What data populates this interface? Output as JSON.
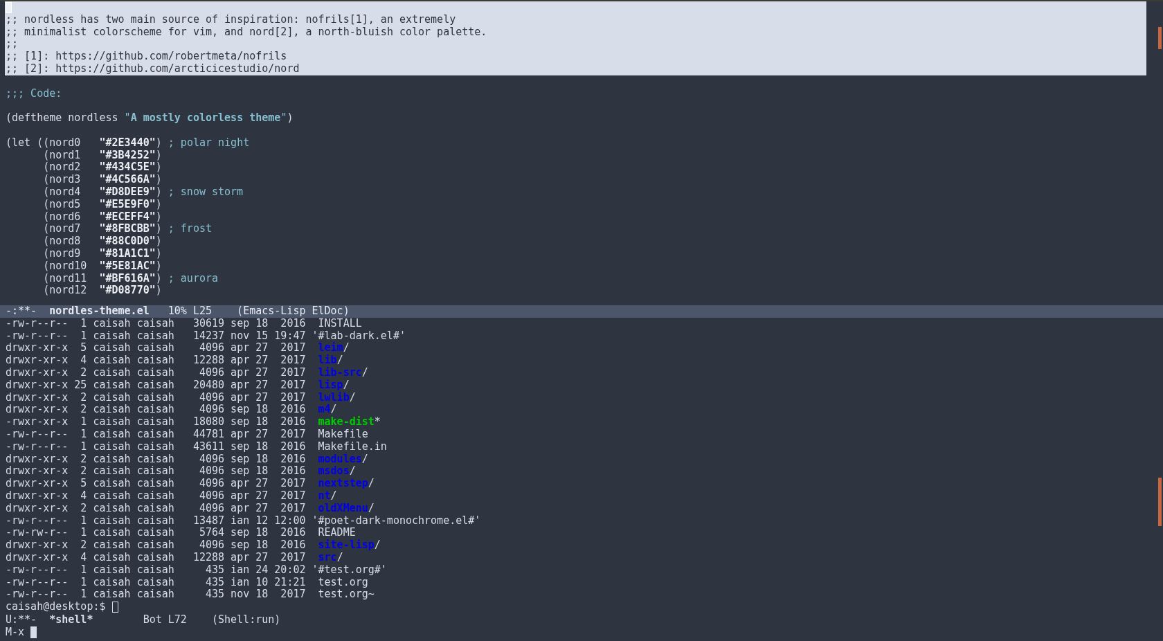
{
  "editor": {
    "lines": [
      {
        "kind": "cursor",
        "highlighted": true
      },
      {
        "kind": "code",
        "highlighted": true,
        "segments": [
          {
            "text": ";; nordless has two main source of inspiration: nofrils[1], an extremely",
            "kind": "comment"
          }
        ]
      },
      {
        "kind": "code",
        "highlighted": true,
        "segments": [
          {
            "text": ";; minimalist colorscheme for vim, and nord[2], a north-bluish color palette.",
            "kind": "comment"
          }
        ]
      },
      {
        "kind": "code",
        "highlighted": true,
        "segments": [
          {
            "text": ";;",
            "kind": "comment"
          }
        ]
      },
      {
        "kind": "code",
        "highlighted": true,
        "segments": [
          {
            "text": ";; [1]: https://github.com/robertmeta/nofrils",
            "kind": "comment"
          }
        ]
      },
      {
        "kind": "code",
        "highlighted": true,
        "segments": [
          {
            "text": ";; [2]: https://github.com/arcticicestudio/nord",
            "kind": "comment"
          }
        ]
      },
      {
        "kind": "blank",
        "highlighted": false
      },
      {
        "kind": "code",
        "highlighted": false,
        "segments": [
          {
            "text": ";;; Code:",
            "kind": "comment"
          }
        ]
      },
      {
        "kind": "blank",
        "highlighted": false
      },
      {
        "kind": "code",
        "highlighted": false,
        "segments": [
          {
            "text": "(deftheme nordless ",
            "kind": "plain"
          },
          {
            "text": "\"",
            "kind": "doc-delim"
          },
          {
            "text": "A mostly colorless theme",
            "kind": "doc"
          },
          {
            "text": "\"",
            "kind": "doc-delim"
          },
          {
            "text": ")",
            "kind": "plain"
          }
        ]
      },
      {
        "kind": "blank",
        "highlighted": false
      },
      {
        "kind": "code",
        "highlighted": false,
        "segments": [
          {
            "text": "(let ((nord0   ",
            "kind": "plain"
          },
          {
            "text": "\"#2E3440\"",
            "kind": "string"
          },
          {
            "text": ")",
            "kind": "plain"
          },
          {
            "text": "; polar night",
            "kind": "comment"
          }
        ],
        "children": [
          {
            "kind": "code",
            "highlighted": false,
            "segments": [
              {
                "text": "(nord1   ",
                "kind": "plain"
              },
              {
                "text": "\"#3B4252\"",
                "kind": "string"
              },
              {
                "text": ")",
                "kind": "plain"
              }
            ]
          },
          {
            "kind": "code",
            "highlighted": false,
            "segments": [
              {
                "text": "(nord2   ",
                "kind": "plain"
              },
              {
                "text": "\"#434C5E\"",
                "kind": "string"
              },
              {
                "text": ")",
                "kind": "plain"
              }
            ]
          },
          {
            "kind": "code",
            "highlighted": false,
            "segments": [
              {
                "text": "(nord3   ",
                "kind": "plain"
              },
              {
                "text": "\"#4C566A\"",
                "kind": "string"
              },
              {
                "text": ")",
                "kind": "plain"
              }
            ]
          },
          {
            "kind": "code",
            "highlighted": false,
            "segments": [
              {
                "text": "(nord4   ",
                "kind": "plain"
              },
              {
                "text": "\"#D8DEE9\"",
                "kind": "string"
              },
              {
                "text": ")",
                "kind": "plain"
              },
              {
                "text": "; snow storm",
                "kind": "comment"
              }
            ]
          },
          {
            "kind": "code",
            "highlighted": false,
            "segments": [
              {
                "text": "(nord5   ",
                "kind": "plain"
              },
              {
                "text": "\"#E5E9F0\"",
                "kind": "string"
              },
              {
                "text": ")",
                "kind": "plain"
              }
            ]
          },
          {
            "kind": "code",
            "highlighted": false,
            "segments": [
              {
                "text": "(nord6   ",
                "kind": "plain"
              },
              {
                "text": "\"#ECEFF4\"",
                "kind": "string"
              },
              {
                "text": ")",
                "kind": "plain"
              }
            ]
          },
          {
            "kind": "code",
            "highlighted": false,
            "segments": [
              {
                "text": "(nord7   ",
                "kind": "plain"
              },
              {
                "text": "\"#8FBCBB\"",
                "kind": "string"
              },
              {
                "text": ")",
                "kind": "plain"
              },
              {
                "text": "; frost",
                "kind": "comment"
              }
            ]
          },
          {
            "kind": "code",
            "highlighted": false,
            "segments": [
              {
                "text": "(nord8   ",
                "kind": "plain"
              },
              {
                "text": "\"#88C0D0\"",
                "kind": "string"
              },
              {
                "text": ")",
                "kind": "plain"
              }
            ]
          },
          {
            "kind": "code",
            "highlighted": false,
            "segments": [
              {
                "text": "(nord9   ",
                "kind": "plain"
              },
              {
                "text": "\"#81A1C1\"",
                "kind": "string"
              },
              {
                "text": ")",
                "kind": "plain"
              }
            ]
          },
          {
            "kind": "code",
            "highlighted": false,
            "segments": [
              {
                "text": "(nord10  ",
                "kind": "plain"
              },
              {
                "text": "\"#5E81AC\"",
                "kind": "string"
              },
              {
                "text": ")",
                "kind": "plain"
              }
            ]
          },
          {
            "kind": "code",
            "highlighted": false,
            "segments": [
              {
                "text": "(nord11  ",
                "kind": "plain"
              },
              {
                "text": "\"#BF616A\"",
                "kind": "string"
              },
              {
                "text": ")",
                "kind": "plain"
              },
              {
                "text": "; aurora",
                "kind": "comment"
              }
            ]
          },
          {
            "kind": "code",
            "highlighted": false,
            "segments": [
              {
                "text": "(nord12  ",
                "kind": "plain"
              },
              {
                "text": "\"#D08770\"",
                "kind": "string"
              },
              {
                "text": ")",
                "kind": "plain"
              }
            ]
          }
        ]
      }
    ],
    "mode_line": {
      "active": true,
      "status": "-:**-",
      "buffer": "nordles-theme.el",
      "position": "10% L25",
      "mode": "(Emacs-Lisp ElDoc)"
    }
  },
  "shell": {
    "rows": [
      {
        "info": "-rw-r--r--  1 caisah caisah   30619 sep 18  2016",
        "name": "INSTALL",
        "kind": "file"
      },
      {
        "info": "-rw-r--r--  1 caisah caisah   14237 nov 15 19:47",
        "name": "'#lab-dark.el#'",
        "kind": "quoted"
      },
      {
        "info": "drwxr-xr-x  5 caisah caisah    4096 apr 27  2017",
        "name": "leim",
        "suffix": "/",
        "kind": "dir"
      },
      {
        "info": "drwxr-xr-x  4 caisah caisah   12288 apr 27  2017",
        "name": "lib",
        "suffix": "/",
        "kind": "dir"
      },
      {
        "info": "drwxr-xr-x  2 caisah caisah    4096 apr 27  2017",
        "name": "lib-src",
        "suffix": "/",
        "kind": "dir"
      },
      {
        "info": "drwxr-xr-x 25 caisah caisah   20480 apr 27  2017",
        "name": "lisp",
        "suffix": "/",
        "kind": "dir"
      },
      {
        "info": "drwxr-xr-x  2 caisah caisah    4096 apr 27  2017",
        "name": "lwlib",
        "suffix": "/",
        "kind": "dir"
      },
      {
        "info": "drwxr-xr-x  2 caisah caisah    4096 sep 18  2016",
        "name": "m4",
        "suffix": "/",
        "kind": "dir"
      },
      {
        "info": "-rwxr-xr-x  1 caisah caisah   18080 sep 18  2016",
        "name": "make-dist",
        "suffix": "*",
        "kind": "exec"
      },
      {
        "info": "-rw-r--r--  1 caisah caisah   44781 apr 27  2017",
        "name": "Makefile",
        "kind": "file"
      },
      {
        "info": "-rw-r--r--  1 caisah caisah   43611 sep 18  2016",
        "name": "Makefile.in",
        "kind": "file"
      },
      {
        "info": "drwxr-xr-x  2 caisah caisah    4096 sep 18  2016",
        "name": "modules",
        "suffix": "/",
        "kind": "dir"
      },
      {
        "info": "drwxr-xr-x  2 caisah caisah    4096 sep 18  2016",
        "name": "msdos",
        "suffix": "/",
        "kind": "dir"
      },
      {
        "info": "drwxr-xr-x  5 caisah caisah    4096 apr 27  2017",
        "name": "nextstep",
        "suffix": "/",
        "kind": "dir"
      },
      {
        "info": "drwxr-xr-x  4 caisah caisah    4096 apr 27  2017",
        "name": "nt",
        "suffix": "/",
        "kind": "dir"
      },
      {
        "info": "drwxr-xr-x  2 caisah caisah    4096 apr 27  2017",
        "name": "oldXMenu",
        "suffix": "/",
        "kind": "dir"
      },
      {
        "info": "-rw-r--r--  1 caisah caisah   13487 ian 12 12:00",
        "name": "'#poet-dark-monochrome.el#'",
        "kind": "quoted"
      },
      {
        "info": "-rw-rw-r--  1 caisah caisah    5764 sep 18  2016",
        "name": "README",
        "kind": "file"
      },
      {
        "info": "drwxr-xr-x  2 caisah caisah    4096 sep 18  2016",
        "name": "site-lisp",
        "suffix": "/",
        "kind": "dir"
      },
      {
        "info": "drwxr-xr-x  4 caisah caisah   12288 apr 27  2017",
        "name": "src",
        "suffix": "/",
        "kind": "dir"
      },
      {
        "info": "-rw-r--r--  1 caisah caisah     435 ian 24 20:02",
        "name": "'#test.org#'",
        "kind": "quoted"
      },
      {
        "info": "-rw-r--r--  1 caisah caisah     435 ian 10 21:21",
        "name": "test.org",
        "kind": "file"
      },
      {
        "info": "-rw-r--r--  1 caisah caisah     435 nov 18  2017",
        "name": "test.org~",
        "kind": "file"
      }
    ],
    "prompt": "caisah@desktop:$",
    "mode_line": {
      "active": false,
      "status": "U:**-",
      "buffer": "*shell*",
      "position": "Bot L72",
      "mode": "(Shell:run)"
    }
  },
  "minibuffer": {
    "prompt": "M-x"
  }
}
